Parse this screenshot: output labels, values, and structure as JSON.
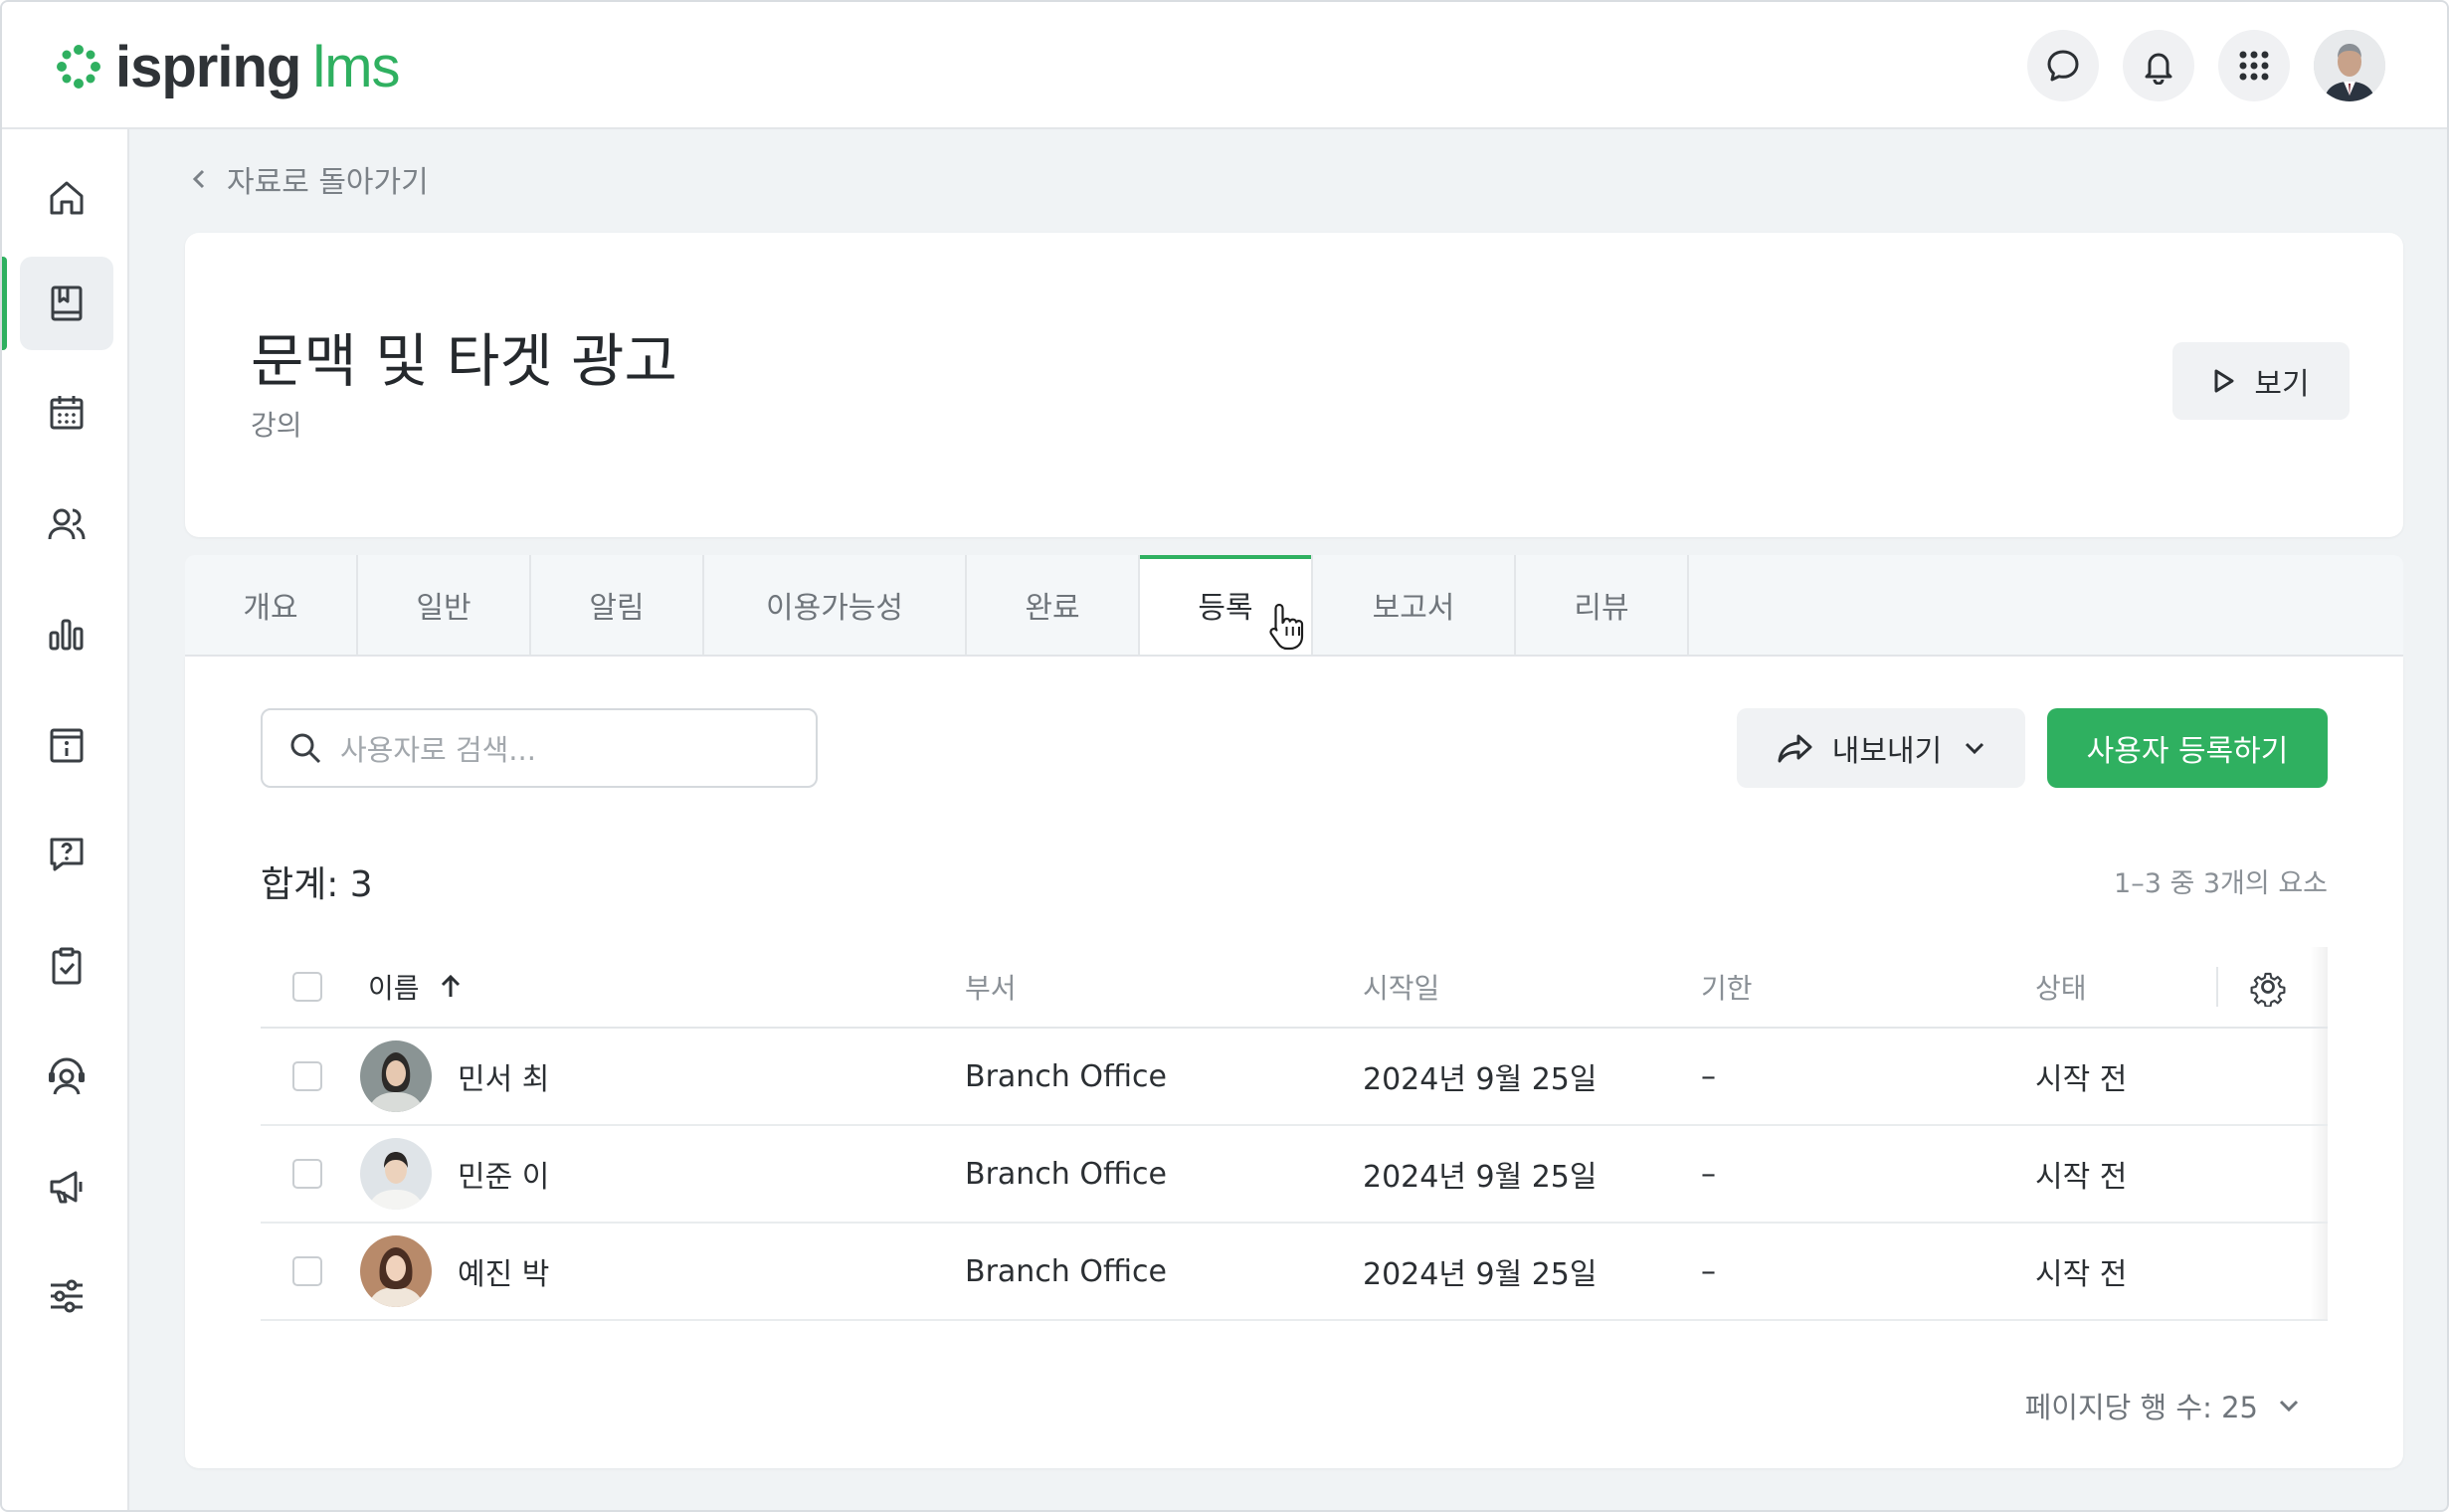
{
  "app": {
    "logo_left": "ispring",
    "logo_right": "lms"
  },
  "topbar": {
    "icons": [
      "chat-icon",
      "bell-icon",
      "apps-grid-icon",
      "user-avatar"
    ]
  },
  "sidebar": {
    "items": [
      {
        "icon": "home-icon"
      },
      {
        "icon": "book-icon",
        "active": true
      },
      {
        "icon": "calendar-icon"
      },
      {
        "icon": "users-icon"
      },
      {
        "icon": "bar-chart-icon"
      },
      {
        "icon": "info-calendar-icon"
      },
      {
        "icon": "help-chat-icon"
      },
      {
        "icon": "clipboard-check-icon"
      },
      {
        "icon": "support-agent-icon"
      },
      {
        "icon": "megaphone-icon"
      },
      {
        "icon": "sliders-icon"
      }
    ]
  },
  "breadcrumb": {
    "back_label": "자료로 돌아가기"
  },
  "header": {
    "title": "문맥 및 타겟 광고",
    "subtitle": "강의",
    "view_label": "보기"
  },
  "tabs": [
    {
      "label": "개요"
    },
    {
      "label": "일반"
    },
    {
      "label": "알림"
    },
    {
      "label": "이용가능성"
    },
    {
      "label": "완료"
    },
    {
      "label": "등록",
      "active": true
    },
    {
      "label": "보고서"
    },
    {
      "label": "리뷰"
    }
  ],
  "toolbar": {
    "search_placeholder": "사용자로 검색...",
    "export_label": "내보내기",
    "enroll_label": "사용자 등록하기"
  },
  "summary": {
    "total_label": "합계: 3",
    "range_label": "1–3 중 3개의 요소"
  },
  "table": {
    "headers": {
      "name": "이름",
      "department": "부서",
      "start_date": "시작일",
      "due": "기한",
      "status": "상태"
    },
    "sort": "name-ascending",
    "rows": [
      {
        "name": "민서 최",
        "department": "Branch Office",
        "start_date": "2024년 9월 25일",
        "due": "–",
        "status": "시작 전"
      },
      {
        "name": "민준 이",
        "department": "Branch Office",
        "start_date": "2024년 9월 25일",
        "due": "–",
        "status": "시작 전"
      },
      {
        "name": "예진 박",
        "department": "Branch Office",
        "start_date": "2024년 9월 25일",
        "due": "–",
        "status": "시작 전"
      }
    ]
  },
  "pagination": {
    "rows_per_page_label": "페이지당 행 수: 25"
  },
  "colors": {
    "accent": "#2fb060",
    "background": "#f0f3f5"
  }
}
